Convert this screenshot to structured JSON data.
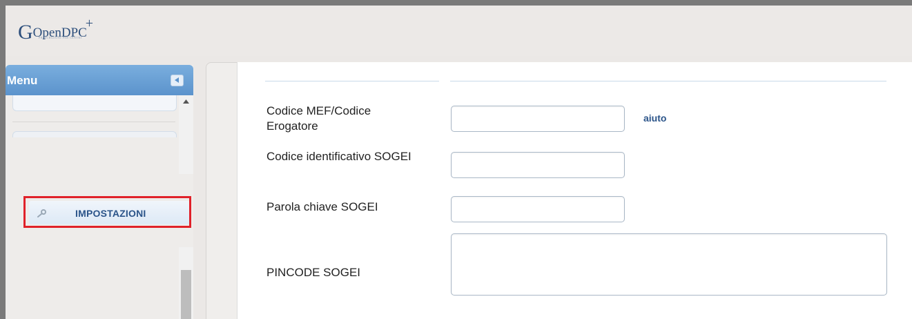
{
  "header": {
    "logo_main": "Open",
    "logo_dpc": "DPC",
    "logo_sub": "PRESCRIZIONI PER CENTRI"
  },
  "sidebar": {
    "menu_title": "Menu",
    "items": [
      {
        "label": "IMPOSTAZIONI",
        "icon": "wrench-icon",
        "highlighted": true
      }
    ]
  },
  "form": {
    "fields": [
      {
        "label": "Codice MEF/Codice Erogatore",
        "value": "",
        "help": "aiuto"
      },
      {
        "label": "Codice identificativo SOGEI",
        "value": ""
      },
      {
        "label": "Parola chiave SOGEI",
        "value": ""
      },
      {
        "label": "PINCODE SOGEI",
        "value": ""
      }
    ]
  },
  "colors": {
    "menu_header": "#5b93cc",
    "highlight_border": "#e02129",
    "link": "#2b5489"
  }
}
